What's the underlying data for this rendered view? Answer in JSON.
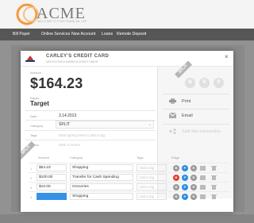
{
  "brand": {
    "name": "ACME",
    "tagline": "WELCOME TO YOUR FINANCIAL LIFE"
  },
  "nav": [
    "Bill Payer",
    "Online Services",
    "New Account",
    "Loans",
    "Remote Deposit"
  ],
  "modal": {
    "title": "CARLEY'S CREDIT CARD",
    "subtitle": "MEA ESTRADA AMERICA CREDIT UNION",
    "close": "×",
    "amount_label": "Amount",
    "amount": "$164.23",
    "payee_label": "Payee",
    "payee": "Target",
    "date_label": "Date",
    "date": "3.14.2013",
    "category_label": "Category",
    "category": "SPLIT",
    "tags_label": "Tags",
    "tags_placeholder": "Start typing here to add a tag",
    "memo_label": "Memo",
    "memo_placeholder": "Start a memo",
    "split_ribbon": "SPLIT",
    "status_buttons": [
      "B",
      "R",
      "P"
    ],
    "actions": [
      {
        "label": "Print",
        "icon": "printer-icon"
      },
      {
        "label": "Email",
        "icon": "email-icon"
      },
      {
        "label": "Split this transaction",
        "icon": "share-icon"
      }
    ],
    "split_table": {
      "headers": {
        "amount": "Amount",
        "category": "Category",
        "tags": "Tags",
        "flags": "Flags"
      },
      "rows": [
        {
          "num": "1",
          "amount": "$54.23",
          "category": "Shopping",
          "tags": "Add a tag",
          "flags": [
            "B",
            "P",
            "R"
          ]
        },
        {
          "num": "2",
          "amount": "$100.00",
          "category": "Transfer for Cash Spending",
          "tags": "Add a tag",
          "flags": [
            "B",
            "P",
            "R"
          ]
        },
        {
          "num": "3",
          "amount": "$10.00",
          "category": "Groceries",
          "tags": "Add a tag",
          "flags": [
            "B",
            "P",
            "R"
          ]
        },
        {
          "num": "4",
          "amount": "",
          "category": "Shopping",
          "tags": "Add a tag",
          "flags": [
            "B",
            "P",
            "R"
          ]
        }
      ]
    }
  },
  "colors": {
    "accent_orange": "#f39a3a",
    "flag_red": "#e0402f",
    "flag_blue": "#2e8ee0",
    "flag_grey": "#9a9a9a",
    "selected_blue": "#3592e6"
  }
}
